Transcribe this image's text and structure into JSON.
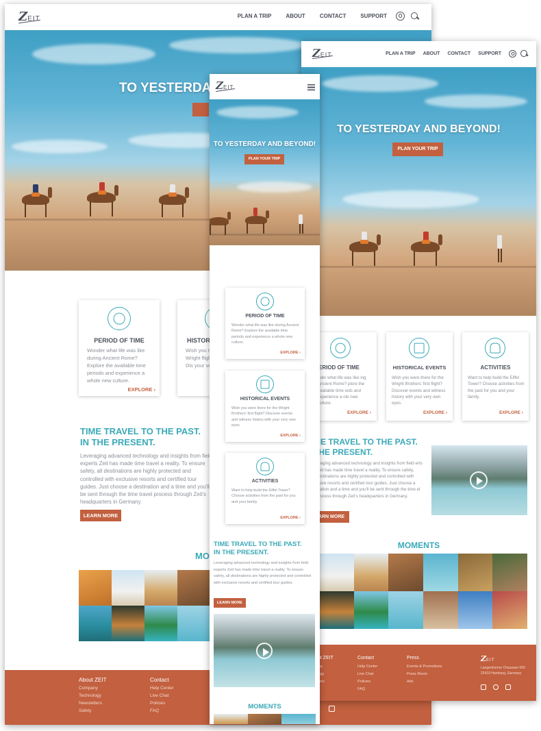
{
  "brand": {
    "logo_z": "Z",
    "logo_rest": "EIT"
  },
  "nav": {
    "links": [
      "PLAN A TRIP",
      "ABOUT",
      "CONTACT",
      "SUPPORT"
    ]
  },
  "hero": {
    "title": "TO YESTERDAY AND BEYOND!",
    "title_partial": "TO YESTERDA",
    "cta": "PLAN YOUR TRIP"
  },
  "cards": [
    {
      "title": "PERIOD OF TIME",
      "icon": "alarm-clock-icon",
      "text": "Wonder what life was like during Ancient Rome? Explore the available time periods and experience a whole new culture.",
      "link": "EXPLORE"
    },
    {
      "title": "HISTORICAL EVENTS",
      "icon": "calendar-icon",
      "text": "Wish you were there for the Wright Brothers' first flight? Discover events and witness history with your very own eyes.",
      "link": "EXPLORE"
    },
    {
      "title": "ACTIVITIES",
      "icon": "scuba-mask-icon",
      "text": "Want to help build the Eiffel Tower? Choose activities from the past for you and your family.",
      "link": "EXPLORE"
    }
  ],
  "desktop_partial": {
    "card2_title": "HISTOR",
    "card2_text": "Wish you the Wright flight? Dis your very",
    "moments": "MO"
  },
  "tablet_partial": {
    "card1_title": "ERIOD OF TIME",
    "card1_text": "nder what life was like ing Ancient Rome? plore the available time iods and experience a ole new culture.",
    "sec_title_1": "ME TRAVEL TO THE PAST.",
    "sec_title_2": "THE PRESENT.",
    "body": "eraging advanced technology and insights from field erts Zeit has made time travel a reality. To ensure safety, destinations are highly protected and controlled with usive resorts and certified tour guides. Just choose a ination and a time and you'll be sent through the time el process through Zeit's headquarters in Germany.",
    "cta": "ARN MORE"
  },
  "section": {
    "title_1": "TIME TRAVEL TO THE PAST.",
    "title_2": "IN THE PRESENT.",
    "body": "Leveraging advanced technology and insights from field experts Zeit has made time travel a reality. To ensure safety, all destinations are highly protected and controlled with exclusive resorts and certified tour guides. Just choose a destination and a time and you'll be sent through the time travel process through Zeit's headquarters in Germany.",
    "body_mobile": "Leveraging advanced technology and insights from field experts Zeit has made time travel a reality. To ensure safety, all destinations are highly protected and controlled with exclusive resorts and certified tour guides.",
    "cta": "LEARN MORE"
  },
  "moments": {
    "title": "MOMENTS"
  },
  "footer": {
    "about_title": "About ZEIT",
    "about_items": [
      "Company",
      "Technology",
      "Newsletters",
      "Safety"
    ],
    "about_partial_title": "out ZEIT",
    "about_partial_items": [
      "any",
      "ology",
      "etters"
    ],
    "contact_title": "Contact",
    "contact_items": [
      "Help Center",
      "Live Chat",
      "Policies",
      "FAQ"
    ],
    "press_title": "Press",
    "press_items": [
      "Events & Promotions",
      "Press Room",
      "Ads"
    ],
    "address": [
      "Langenhorner Chaussee 600",
      "22419 Hamburg, Germany"
    ],
    "social": [
      "facebook-icon",
      "instagram-icon",
      "twitter-icon"
    ]
  },
  "colors": {
    "accent": "#3aa9b8",
    "brand": "#c2603f",
    "text": "#4a4f5a",
    "muted": "#8a8f96"
  }
}
